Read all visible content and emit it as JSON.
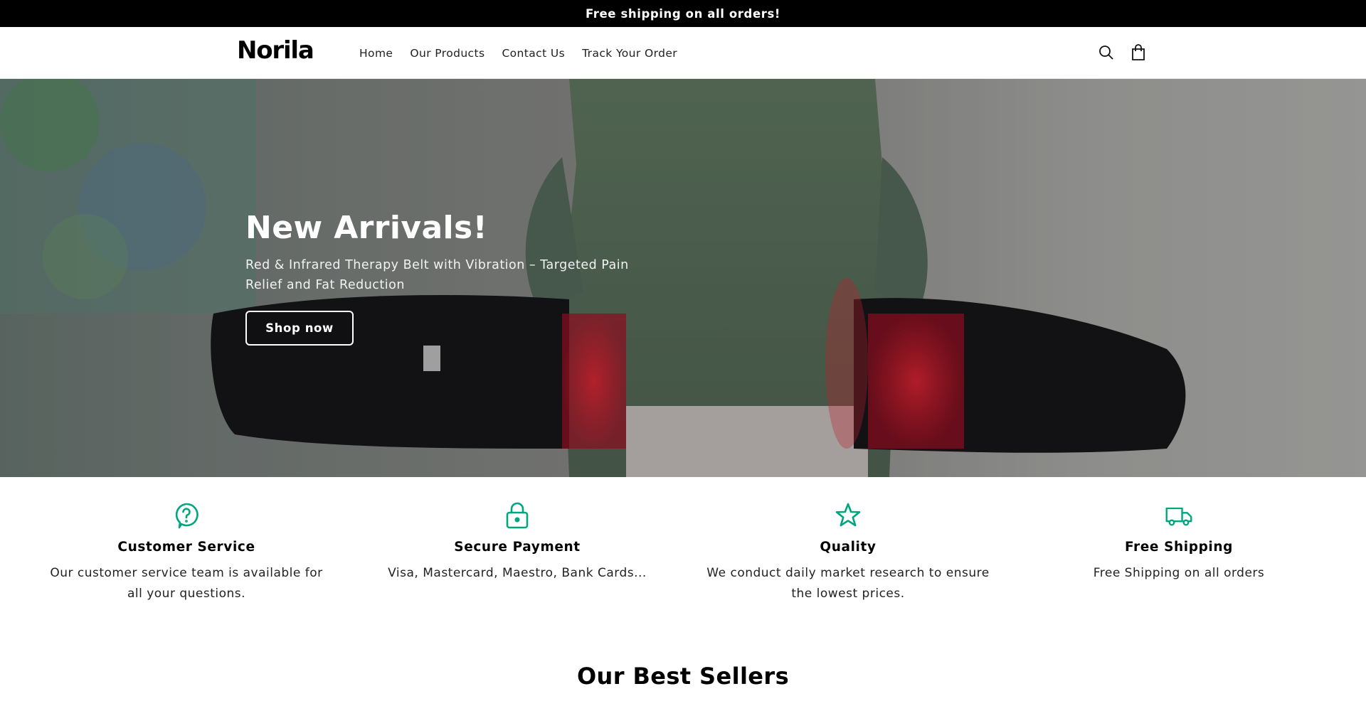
{
  "announcement": {
    "text": "Free shipping on all orders!"
  },
  "header": {
    "logo": "Norila",
    "nav": [
      "Home",
      "Our Products",
      "Contact Us",
      "Track Your Order"
    ],
    "icons": [
      "search-icon",
      "cart-icon"
    ]
  },
  "hero": {
    "title": "New Arrivals!",
    "subtitle": "Red & Infrared Therapy Belt with Vibration – Targeted Pain Relief and Fat Reduction",
    "button_label": "Shop now"
  },
  "features": [
    {
      "icon": "question-bubble-icon",
      "title": "Customer Service",
      "text": "Our customer service team is available for all your questions."
    },
    {
      "icon": "lock-icon",
      "title": "Secure Payment",
      "text": "Visa, Mastercard, Maestro, Bank Cards..."
    },
    {
      "icon": "star-icon",
      "title": "Quality",
      "text": "We conduct daily market research to ensure the lowest prices."
    },
    {
      "icon": "truck-icon",
      "title": "Free Shipping",
      "text": "Free Shipping on all orders"
    }
  ],
  "best_sellers": {
    "heading": "Our Best Sellers"
  },
  "colors": {
    "accent": "#00a67e",
    "announcement_bg": "#000000",
    "text": "#121212"
  }
}
